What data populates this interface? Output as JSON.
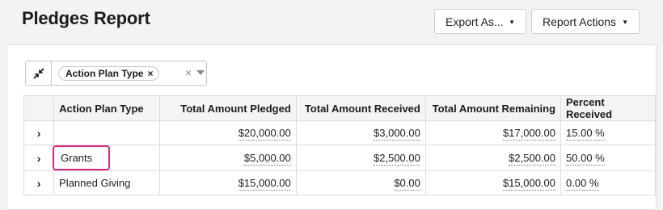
{
  "page": {
    "title": "Pledges Report"
  },
  "header": {
    "export_label": "Export As...",
    "report_actions_label": "Report Actions"
  },
  "filter": {
    "chip_label": "Action Plan Type",
    "chip_remove": "×",
    "clear": "×"
  },
  "table": {
    "columns": [
      "Action Plan Type",
      "Total Amount Pledged",
      "Total Amount Received",
      "Total Amount Remaining",
      "Percent Received"
    ],
    "rows": [
      {
        "type": "",
        "pledged": "$20,000.00",
        "received": "$3,000.00",
        "remaining": "$17,000.00",
        "percent": "15.00 %"
      },
      {
        "type": "Grants",
        "pledged": "$5,000.00",
        "received": "$2,500.00",
        "remaining": "$2,500.00",
        "percent": "50.00 %"
      },
      {
        "type": "Planned Giving",
        "pledged": "$15,000.00",
        "received": "$0.00",
        "remaining": "$15,000.00",
        "percent": "0.00 %"
      }
    ]
  },
  "colors": {
    "highlight": "#d6257f"
  },
  "icons": {
    "collapse": "collapse-arrows-icon",
    "expand_row": "chevron-right-icon"
  }
}
